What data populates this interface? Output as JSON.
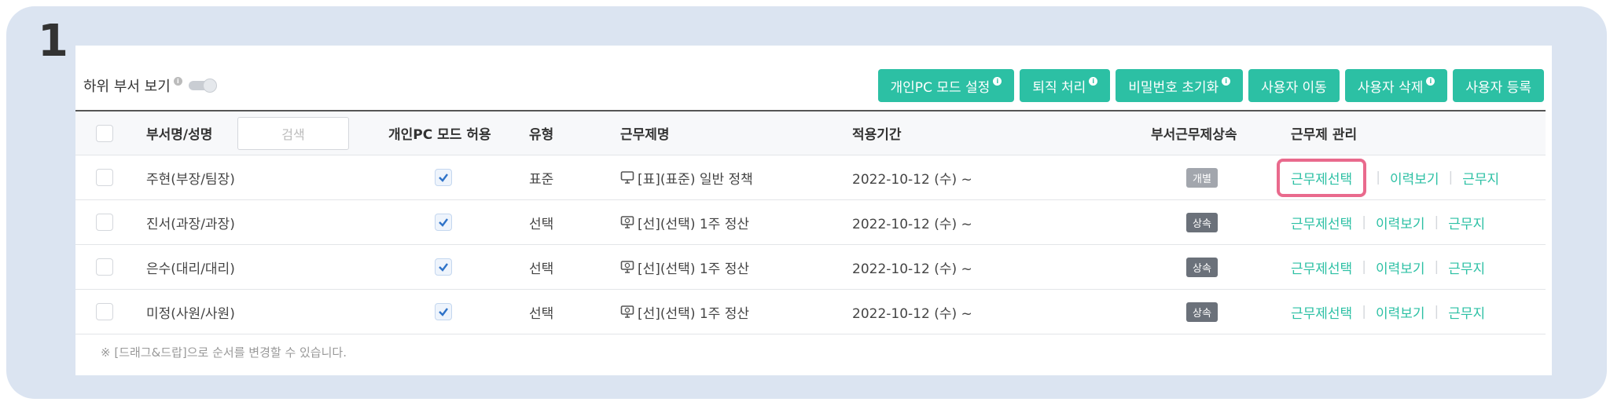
{
  "step": "1",
  "toolbar": {
    "subdept_label": "하위 부서 보기",
    "buttons": [
      "개인PC 모드 설정",
      "퇴직 처리",
      "비밀번호 초기화",
      "사용자 이동",
      "사용자 삭제",
      "사용자 등록"
    ]
  },
  "table": {
    "headers": {
      "name": "부서명/성명",
      "search_placeholder": "검색",
      "pc_mode": "개인PC 모드 허용",
      "type": "유형",
      "work_name": "근무제명",
      "period": "적용기간",
      "inherit": "부서근무제상속",
      "manage": "근무제 관리"
    },
    "rows": [
      {
        "name": "주현(부장/팀장)",
        "pc_allowed": true,
        "type": "표준",
        "work_name": "[표](표준) 일반 정책",
        "period": "2022-10-12 (수) ~",
        "inherit": "개별",
        "actions": [
          "근무제선택",
          "이력보기",
          "근무지"
        ]
      },
      {
        "name": "진서(과장/과장)",
        "pc_allowed": true,
        "type": "선택",
        "work_name": "[선](선택) 1주 정산",
        "period": "2022-10-12 (수) ~",
        "inherit": "상속",
        "actions": [
          "근무제선택",
          "이력보기",
          "근무지"
        ]
      },
      {
        "name": "은수(대리/대리)",
        "pc_allowed": true,
        "type": "선택",
        "work_name": "[선](선택) 1주 정산",
        "period": "2022-10-12 (수) ~",
        "inherit": "상속",
        "actions": [
          "근무제선택",
          "이력보기",
          "근무지"
        ]
      },
      {
        "name": "미정(사원/사원)",
        "pc_allowed": true,
        "type": "선택",
        "work_name": "[선](선택) 1주 정산",
        "period": "2022-10-12 (수) ~",
        "inherit": "상속",
        "actions": [
          "근무제선택",
          "이력보기",
          "근무지"
        ]
      }
    ]
  },
  "footer_note": "※ [드래그&드랍]으로 순서를 변경할 수 있습니다.",
  "colors": {
    "accent": "#2cc0a4",
    "highlight": "#e96a8d",
    "frame": "#dbe4f1"
  }
}
